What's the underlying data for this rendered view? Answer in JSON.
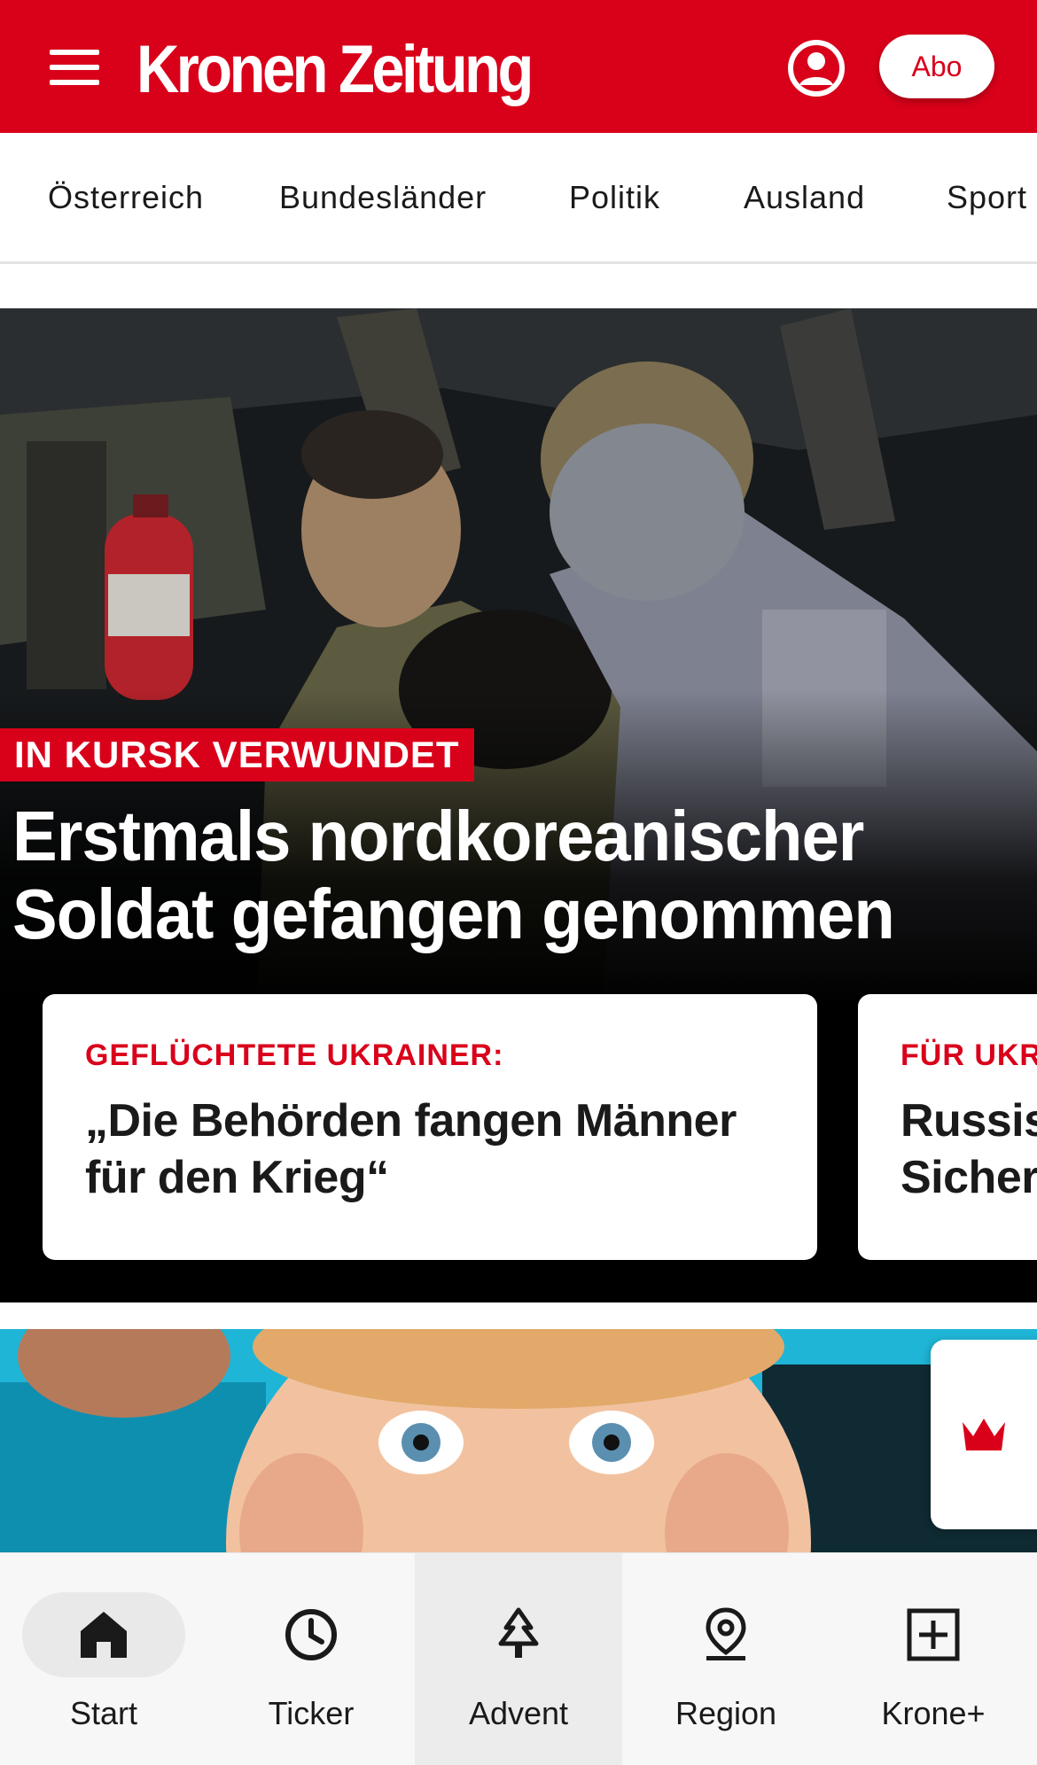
{
  "header": {
    "brand": "Kronen Zeitung",
    "abo_label": "Abo",
    "colors": {
      "brand_red": "#d9001a"
    }
  },
  "categories": [
    "Österreich",
    "Bundesländer",
    "Politik",
    "Ausland",
    "Sport"
  ],
  "hero": {
    "kicker": "IN KURSK VERWUNDET",
    "headline_line1": "Erstmals nordkoreanischer",
    "headline_line2": "Soldat gefangen genommen"
  },
  "cards": [
    {
      "kicker": "GEFLÜCHTETE UKRAINER:",
      "title_line1": "„Die Behörden fangen Männer",
      "title_line2": "für den Krieg“"
    },
    {
      "kicker": "FÜR UKR",
      "title_line1": "Russis",
      "title_line2": "Sicher"
    }
  ],
  "bottom_nav": [
    {
      "label": "Start",
      "icon": "home-icon"
    },
    {
      "label": "Ticker",
      "icon": "clock-icon"
    },
    {
      "label": "Advent",
      "icon": "tree-icon"
    },
    {
      "label": "Region",
      "icon": "location-pin-icon"
    },
    {
      "label": "Krone+",
      "icon": "plus-square-icon"
    }
  ]
}
